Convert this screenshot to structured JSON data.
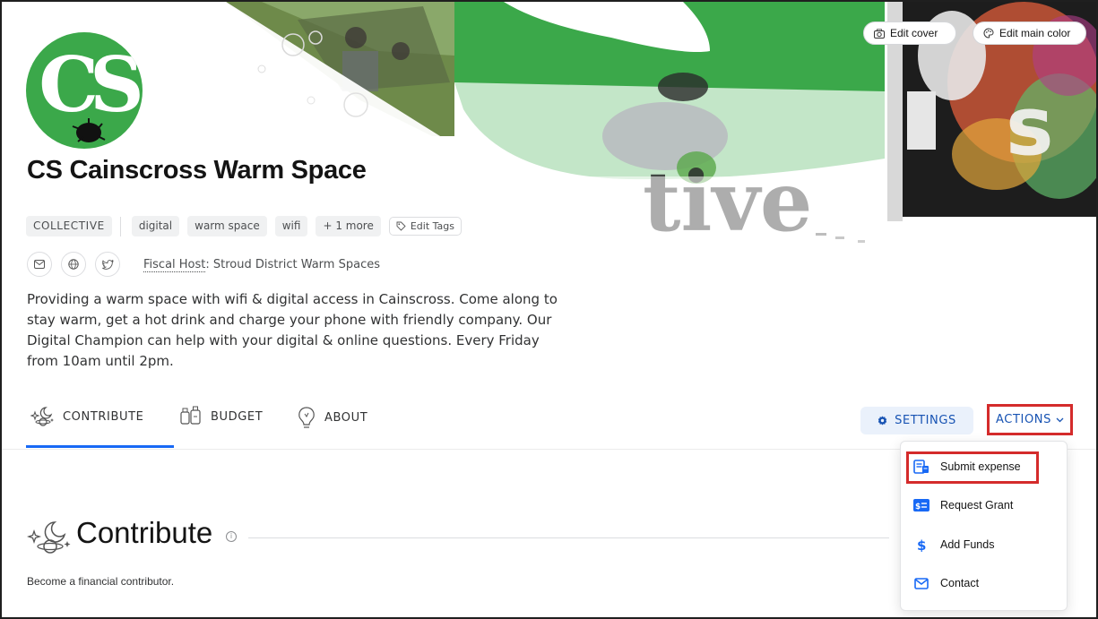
{
  "cover": {
    "edit_cover_label": "Edit cover",
    "edit_main_color_label": "Edit main color",
    "accent_green": "#3ba84a"
  },
  "profile": {
    "avatar_text": "CS",
    "name": "CS Cainscross Warm Space",
    "type_tag": "COLLECTIVE",
    "tags": [
      "digital",
      "warm space",
      "wifi",
      "+ 1 more"
    ],
    "edit_tags_label": "Edit Tags",
    "social_icons": [
      "email-icon",
      "globe-icon",
      "twitter-icon"
    ],
    "fiscal_host_label": "Fiscal Host",
    "fiscal_host_value": ": Stroud District Warm Spaces",
    "description": "Providing a warm space with wifi & digital access in Cainscross. Come along to stay warm, get a hot drink and charge your phone with friendly company. Our Digital Champion can help with your digital & online questions. Every Friday from 10am until 2pm."
  },
  "nav": {
    "tabs": [
      {
        "label": "CONTRIBUTE",
        "icon": "contribute-icon",
        "active": true
      },
      {
        "label": "BUDGET",
        "icon": "budget-icon",
        "active": false
      },
      {
        "label": "ABOUT",
        "icon": "about-icon",
        "active": false
      }
    ],
    "settings_label": "SETTINGS",
    "actions_label": "ACTIONS",
    "accent_blue": "#1869f5"
  },
  "actions_menu": {
    "items": [
      {
        "label": "Submit expense",
        "icon": "receipt-icon"
      },
      {
        "label": "Request Grant",
        "icon": "grant-icon"
      },
      {
        "label": "Add Funds",
        "icon": "dollar-icon"
      },
      {
        "label": "Contact",
        "icon": "envelope-icon"
      }
    ]
  },
  "section": {
    "title": "Contribute",
    "subtitle": "Become a financial contributor."
  }
}
